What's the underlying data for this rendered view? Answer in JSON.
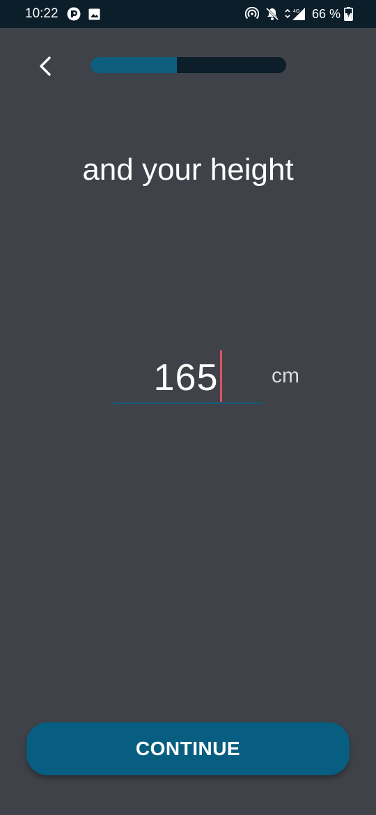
{
  "status_bar": {
    "time": "10:22",
    "left_icons": [
      "app-notification-icon",
      "image-icon"
    ],
    "right_icons": [
      "hotspot-icon",
      "notifications-off-icon",
      "signal-4g-icon",
      "battery-charging-icon"
    ],
    "network_label": "4G",
    "battery_percent": "66 %"
  },
  "header": {
    "back_icon": "chevron-left-icon",
    "progress_fraction": 0.44
  },
  "main": {
    "title": "and your height",
    "height_value": "165",
    "unit": "cm"
  },
  "footer": {
    "continue_label": "CONTINUE"
  },
  "colors": {
    "background": "#40424A",
    "status_bar": "#0C1E2A",
    "accent": "#0E5E80",
    "caret": "#E0505C"
  }
}
